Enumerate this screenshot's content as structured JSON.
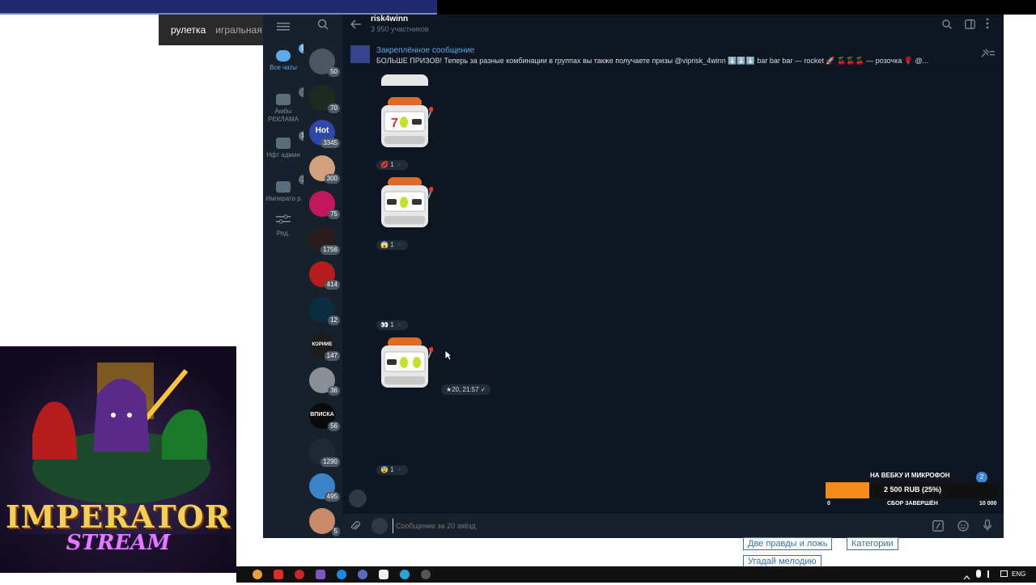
{
  "background_tabs": {
    "active": "рулетка",
    "inactive": "игральная к"
  },
  "folders": [
    {
      "label": "Все чаты",
      "count": "999",
      "icon": "chat-bubble-icon",
      "active": true
    },
    {
      "label": "Амбы РЕКЛАМА",
      "count": "7",
      "icon": "folder-icon",
      "active": false
    },
    {
      "label": "Нфт админ",
      "count": "12",
      "icon": "folder-icon",
      "active": false
    },
    {
      "label": "Императо р",
      "count": "2",
      "icon": "folder-icon",
      "active": false
    },
    {
      "label": "Ред.",
      "count": "",
      "icon": "sliders-icon",
      "active": false
    }
  ],
  "chats": [
    {
      "count": "50",
      "color": "#4a5866",
      "text": ""
    },
    {
      "count": "70",
      "color": "#1e2a20",
      "text": ""
    },
    {
      "count": "3345",
      "color": "#2f47a8",
      "text": "Hot"
    },
    {
      "count": "300",
      "color": "#d2a07a",
      "text": ""
    },
    {
      "count": "75",
      "color": "#c2185b",
      "text": ""
    },
    {
      "count": "1756",
      "color": "#2a1c1c",
      "text": ""
    },
    {
      "count": "414",
      "color": "#b71c1c",
      "text": ""
    },
    {
      "count": "12",
      "color": "#0b2d40",
      "text": ""
    },
    {
      "count": "147",
      "color": "#1c1c1c",
      "text": "КОРИИЕ"
    },
    {
      "count": "36",
      "color": "#8a8f96",
      "text": ""
    },
    {
      "count": "56",
      "color": "#0a0a0a",
      "text": "ВПИСКА"
    },
    {
      "count": "1290",
      "color": "#1d2a36",
      "text": ""
    },
    {
      "count": "495",
      "color": "#3a83c8",
      "text": ""
    },
    {
      "count": "5",
      "color": "#c98a6a",
      "text": ""
    }
  ],
  "header": {
    "title": "risk4winn",
    "subtitle": "3 950 участников"
  },
  "pinned": {
    "title": "Закреплённое сообщение",
    "text": "БОЛЬШЕ ПРИЗОВ! Теперь за разные комбинации в группах вы также получаете призы @viprisk_4winn ⬇️⬇️⬇️ bar bar bar — rocket 🚀 🍒🍒🍒 — розочка 🌹 @..."
  },
  "messages": [
    {
      "reaction": "💋 1 ▪️",
      "time": ""
    },
    {
      "reaction": "😱 1 ▪️",
      "time": ""
    },
    {
      "reaction": "👀 1 ▪️",
      "time": ""
    },
    {
      "reaction": "",
      "time": "★20, 21:57 ✓"
    },
    {
      "reaction": "😨 1 ▪️",
      "time": ""
    }
  ],
  "composer": {
    "placeholder": "Сообщение за 20 звёзд"
  },
  "donation": {
    "title": "НА ВЕБКУ И МИКРОФОН",
    "badge": "2",
    "amount": "2 500 RUB (25%)",
    "progress": 0.25,
    "min": "0",
    "status": "СБОР ЗАВЕРШЁН",
    "max": "10 000"
  },
  "logo": {
    "line1": "IMPERATOR",
    "line2": "STREAM"
  },
  "bottom_tags": [
    "Две правды и ложь",
    "Категории",
    "Угадай мелодию"
  ],
  "taskbar": {
    "lang": "ENG"
  },
  "colors": {
    "accent": "#5fa9e7",
    "tg_bg": "#0e1621",
    "panel": "#17212b",
    "donation_fill": "#f28a1c"
  }
}
